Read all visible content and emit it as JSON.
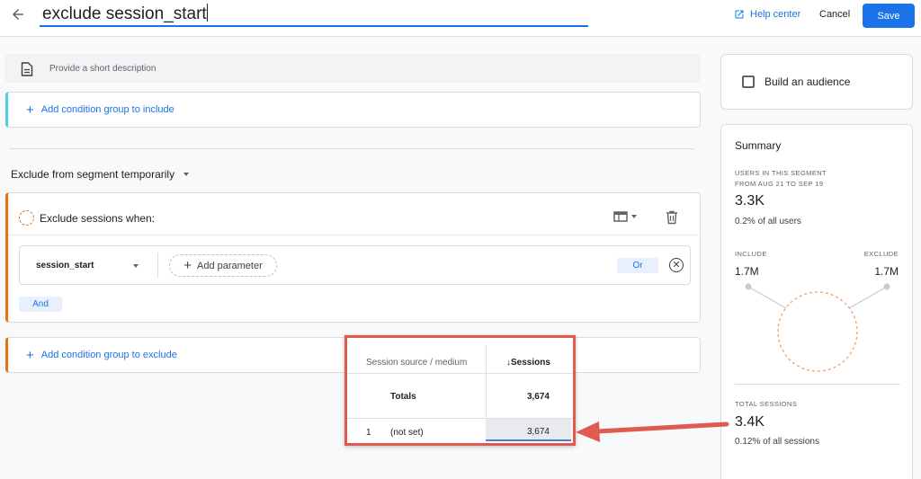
{
  "header": {
    "segment_name": "exclude session_start",
    "help_label": "Help center",
    "cancel_label": "Cancel",
    "save_label": "Save"
  },
  "description": {
    "placeholder": "Provide a short description"
  },
  "include": {
    "add_group_label": "Add condition group to include"
  },
  "exclude": {
    "mode_label": "Exclude from segment temporarily",
    "condition_title": "Exclude sessions when:",
    "event_name": "session_start",
    "add_parameter_label": "Add parameter",
    "or_label": "Or",
    "and_label": "And",
    "add_group_label": "Add condition group to exclude"
  },
  "audience": {
    "label": "Build an audience"
  },
  "summary": {
    "title": "Summary",
    "users_caption_1": "USERS IN THIS SEGMENT",
    "users_caption_2": "FROM AUG 21 TO SEP 19",
    "users_value": "3.3K",
    "users_pct": "0.2% of all users",
    "include_caption": "INCLUDE",
    "include_value": "1.7M",
    "exclude_caption": "EXCLUDE",
    "exclude_value": "1.7M",
    "sessions_caption": "TOTAL SESSIONS",
    "sessions_value": "3.4K",
    "sessions_pct": "0.12% of all sessions"
  },
  "overlay_table": {
    "col_dimension": "Session source / medium",
    "col_metric": "Sessions",
    "totals_label": "Totals",
    "totals_value": "3,674",
    "rows": [
      {
        "index": "1",
        "dimension": "(not set)",
        "value": "3,674"
      }
    ]
  },
  "colors": {
    "accent": "#1a73e8",
    "include_bar": "#4ecde6",
    "exclude_bar": "#e8710a",
    "annotation": "#e05a4f"
  }
}
